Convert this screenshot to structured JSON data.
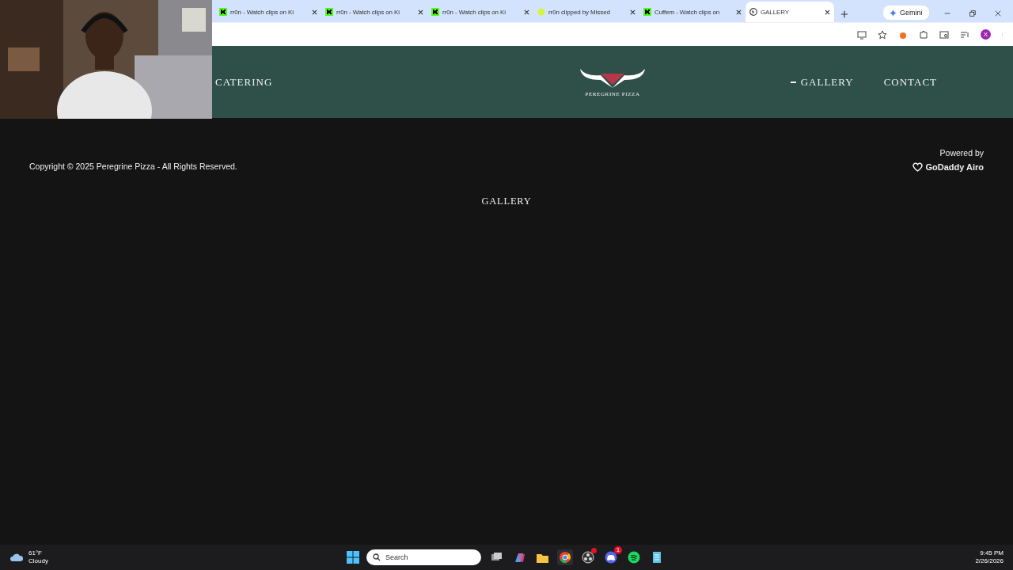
{
  "browser": {
    "tabs": [
      {
        "title": "rr0n - Watch clips on Ki",
        "kind": "kick",
        "selected": false
      },
      {
        "title": "rr0n - Watch clips on Ki",
        "kind": "kick",
        "selected": false
      },
      {
        "title": "rr0n - Watch clips on Ki",
        "kind": "kick",
        "selected": false
      },
      {
        "title": "rr0n clipped by Missed",
        "kind": "dot",
        "selected": false
      },
      {
        "title": "Cuffem - Watch clips on",
        "kind": "kick",
        "selected": false
      },
      {
        "title": "GALLERY",
        "kind": "globe",
        "selected": true
      }
    ],
    "gemini": "Gemini",
    "profile": "X"
  },
  "site": {
    "nav_left": [
      {
        "label": "CATERING",
        "selected": false
      }
    ],
    "logo": {
      "name": "PEREGRINE PIZZA"
    },
    "nav_right": [
      {
        "label": "GALLERY",
        "selected": true
      },
      {
        "label": "CONTACT",
        "selected": false
      }
    ],
    "copyright": "Copyright © 2025 Peregrine Pizza - All Rights Reserved.",
    "powered_by": "Powered by",
    "powered_brand": "GoDaddy Airo",
    "heading": "GALLERY"
  },
  "taskbar": {
    "weather": {
      "temp": "61°F",
      "condition": "Cloudy"
    },
    "search": {
      "placeholder": "Search"
    },
    "apps": [
      {
        "kind": "taskview",
        "alert": false,
        "active": false
      },
      {
        "kind": "copilot",
        "alert": false,
        "active": false
      },
      {
        "kind": "folder",
        "alert": false,
        "active": false
      },
      {
        "kind": "chrome",
        "alert": false,
        "active": true
      },
      {
        "kind": "obs",
        "alert": true,
        "active": false
      },
      {
        "kind": "discord",
        "alert": false,
        "badge": "1",
        "active": false
      },
      {
        "kind": "spotify",
        "alert": false,
        "active": false
      },
      {
        "kind": "notepad",
        "alert": false,
        "active": false
      }
    ],
    "time": "9:45 PM",
    "date": "2/26/2026"
  }
}
